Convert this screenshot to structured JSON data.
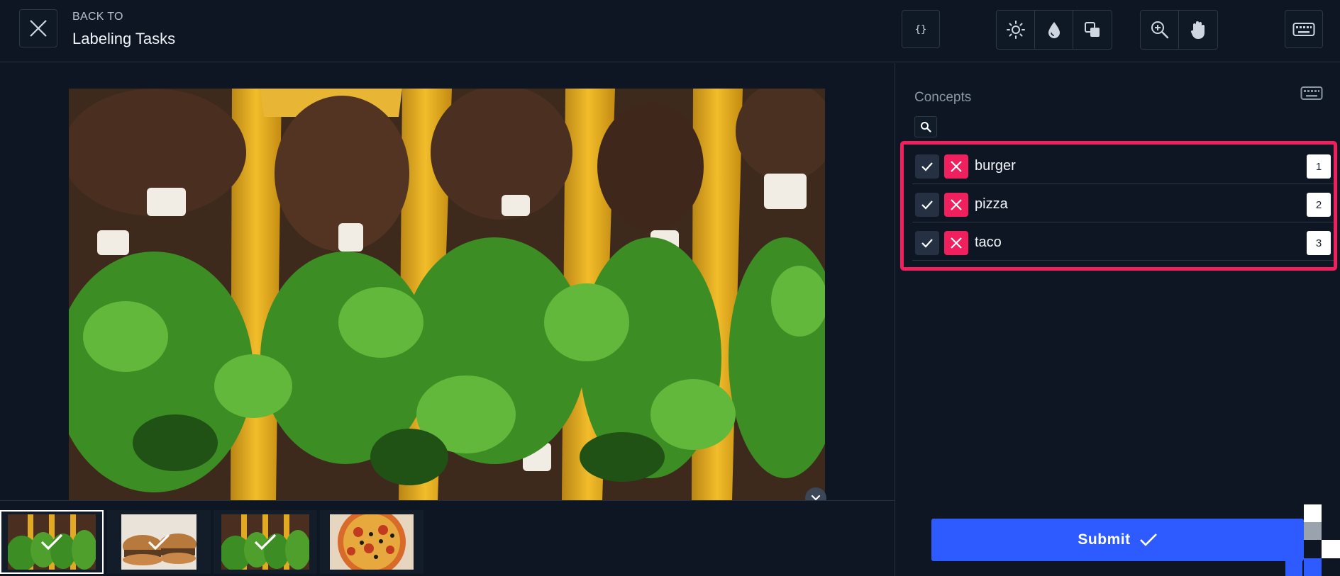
{
  "header": {
    "back_label": "BACK TO",
    "back_title": "Labeling Tasks",
    "icons": {
      "close": "close-icon",
      "json": "code-braces-icon",
      "brightness": "sun-icon",
      "saturation": "droplet-icon",
      "contrast": "contrast-icon",
      "zoom": "zoom-in-icon",
      "pan": "hand-icon",
      "keyboard": "keyboard-icon"
    }
  },
  "sidebar": {
    "title": "Concepts",
    "concepts": [
      {
        "label": "burger",
        "key": "1"
      },
      {
        "label": "pizza",
        "key": "2"
      },
      {
        "label": "taco",
        "key": "3"
      }
    ]
  },
  "thumbnails": [
    {
      "subject": "tacos",
      "reviewed": true,
      "selected": true
    },
    {
      "subject": "burgers",
      "reviewed": true,
      "selected": false
    },
    {
      "subject": "tacos",
      "reviewed": true,
      "selected": false
    },
    {
      "subject": "pizza",
      "reviewed": false,
      "selected": false
    }
  ],
  "actions": {
    "submit_label": "Submit"
  },
  "colors": {
    "background": "#0d1622",
    "accent_pink": "#f0205e",
    "accent_blue": "#2e5bff"
  }
}
